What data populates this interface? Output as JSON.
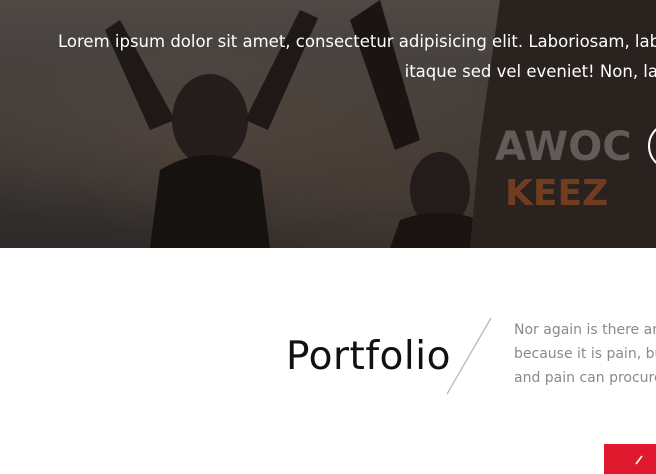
{
  "hero": {
    "line1": "Lorem ipsum dolor sit amet, consectetur adipisicing elit. Laboriosam, labo",
    "line2": "itaque sed vel eveniet! Non, la"
  },
  "portfolio": {
    "title": "Portfolio",
    "intro_lines": [
      "Nor again is there an",
      "because it is pain, bu",
      "and pain can procure"
    ]
  },
  "colors": {
    "accent": "#e1192f",
    "title": "#111111",
    "intro_text": "#8a8a8a"
  },
  "icons": {
    "hero_button": "circle-button-icon",
    "red_button": "chevron-icon"
  }
}
